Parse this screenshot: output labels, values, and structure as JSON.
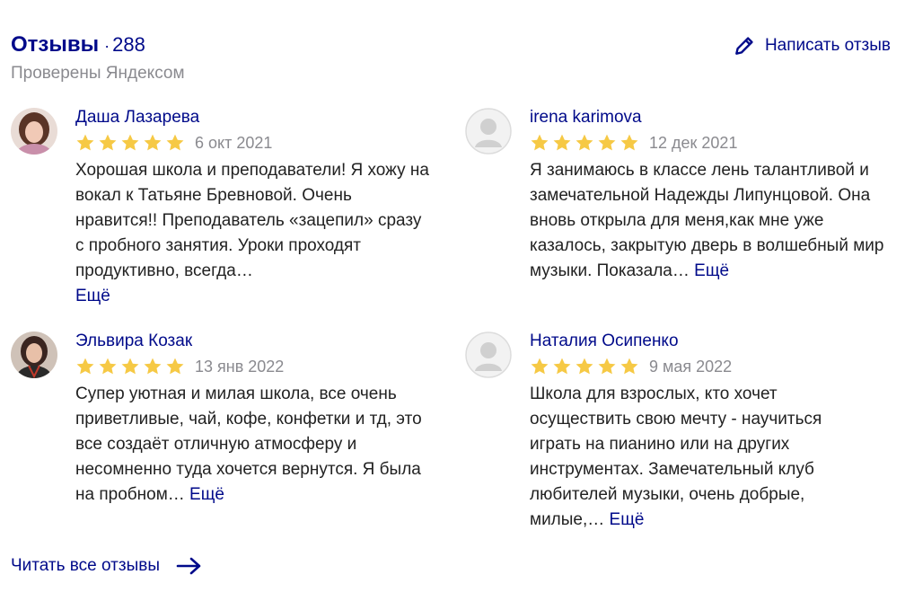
{
  "header": {
    "title": "Отзывы",
    "separator": "·",
    "count": "288",
    "subtitle": "Проверены Яндексом",
    "write_label": "Написать отзыв"
  },
  "reviews": [
    {
      "author": "Даша Лазарева",
      "rating": 5,
      "date": "6 окт 2021",
      "text": "Хорошая школа и преподаватели! Я хожу на вокал к Татьяне Бревновой. Очень нравится!! Преподаватель «зацепил» сразу с пробного занятия. Уроки проходят продуктивно, всегда…",
      "more": "Ещё"
    },
    {
      "author": "irena karimova",
      "rating": 5,
      "date": "12 дек 2021",
      "text": "Я занимаюсь в классе лень талантливой и замечательной Надежды Липунцовой. Она вновь открыла для меня,как мне уже казалось, закрытую дверь в волшебный мир музыки. Показала…",
      "more": "Ещё"
    },
    {
      "author": "Эльвира Козак",
      "rating": 5,
      "date": "13 янв 2022",
      "text": "Супер уютная и милая школа, все очень приветливые, чай, кофе, конфетки и тд, это все создаёт отличную атмосферу и несомненно туда хочется вернутся. Я была на пробном…",
      "more": "Ещё"
    },
    {
      "author": "Наталия Осипенко",
      "rating": 5,
      "date": "9 мая 2022",
      "text": "Школа для взрослых, кто хочет осуществить свою мечту - научиться играть на пианино или на других инструментах. Замечательный клуб любителей музыки, очень добрые, милые,…",
      "more": "Ещё"
    }
  ],
  "footer": {
    "read_all_label": "Читать все отзывы"
  },
  "colors": {
    "link": "#000a8a",
    "star": "#f6c945",
    "muted": "#8a8a8f"
  }
}
